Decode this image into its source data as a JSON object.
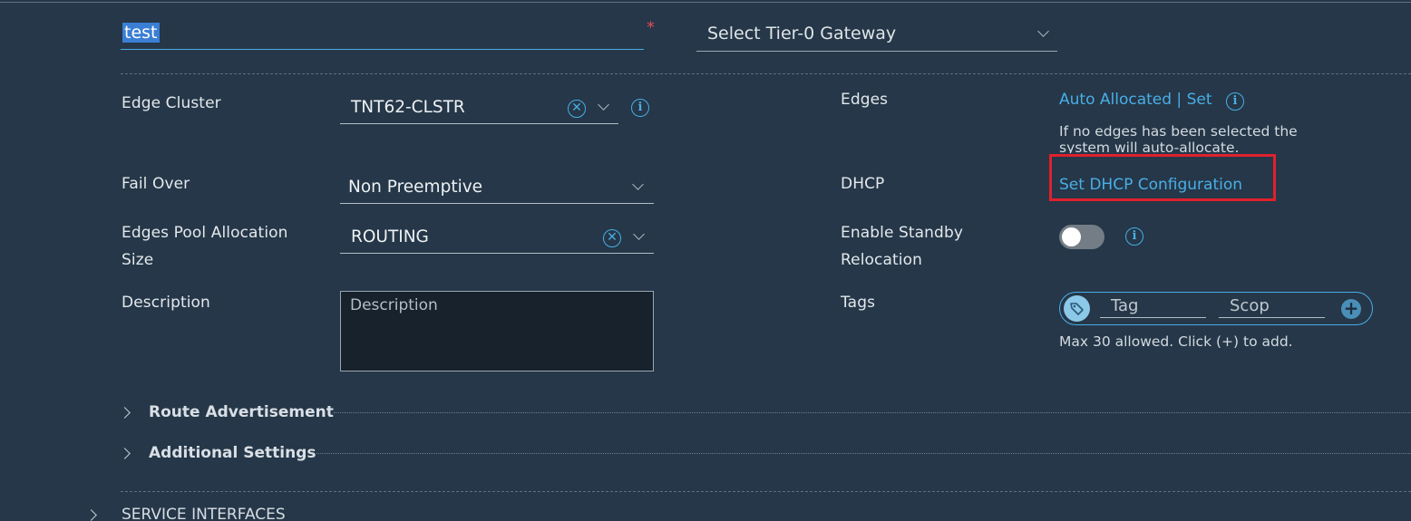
{
  "form": {
    "name_value": "test",
    "required_marker": "*",
    "tier0_placeholder": "Select Tier-0 Gateway",
    "edge_cluster": {
      "label": "Edge Cluster",
      "value": "TNT62-CLSTR"
    },
    "fail_over": {
      "label": "Fail Over",
      "value": "Non Preemptive"
    },
    "edges_pool": {
      "label_line1": "Edges Pool Allocation",
      "label_line2": "Size",
      "value": "ROUTING"
    },
    "description": {
      "label": "Description",
      "placeholder": "Description"
    },
    "edges": {
      "label": "Edges",
      "link": "Auto Allocated | Set",
      "hint_line1": "If no edges has been selected the",
      "hint_line2": "system will auto-allocate."
    },
    "dhcp": {
      "label": "DHCP",
      "link": "Set DHCP Configuration"
    },
    "standby": {
      "label_line1": "Enable Standby",
      "label_line2": "Relocation",
      "enabled": false
    },
    "tags": {
      "label": "Tags",
      "tag_placeholder": "Tag",
      "scope_placeholder": "Scop",
      "hint": "Max 30 allowed. Click (+) to add."
    }
  },
  "sections": {
    "route_advertisement": "Route Advertisement",
    "additional_settings": "Additional Settings",
    "service_interfaces": "SERVICE INTERFACES"
  },
  "colors": {
    "background": "#253748",
    "accent": "#49aee6",
    "highlight_box": "#e0202e",
    "required": "#e0495a"
  }
}
